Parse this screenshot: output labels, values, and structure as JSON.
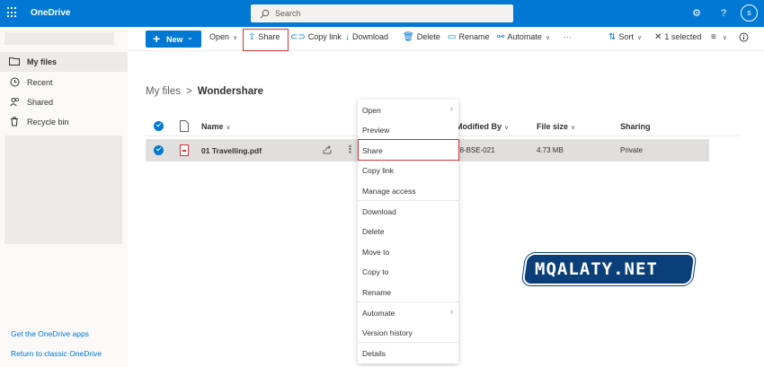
{
  "app": {
    "brand": "OneDrive"
  },
  "search": {
    "placeholder": "Search"
  },
  "topbar": {
    "settings_icon": "gear-icon",
    "help_label": "?",
    "avatar_initial": "s"
  },
  "leftnav": {
    "items": [
      {
        "label": "My files",
        "icon": "folder-icon",
        "active": true
      },
      {
        "label": "Recent",
        "icon": "clock-icon"
      },
      {
        "label": "Shared",
        "icon": "people-icon"
      },
      {
        "label": "Recycle bin",
        "icon": "trash-icon"
      }
    ],
    "get_apps": "Get the OneDrive apps",
    "classic": "Return to classic OneDrive"
  },
  "toolbar": {
    "new_label": "New",
    "open_label": "Open",
    "share_label": "Share",
    "copy_link_label": "Copy link",
    "download_label": "Download",
    "delete_label": "Delete",
    "rename_label": "Rename",
    "automate_label": "Automate",
    "more_label": "···",
    "sort_label": "Sort",
    "selected_label": "1 selected"
  },
  "breadcrumb": {
    "root": "My files",
    "separator": ">",
    "current": "Wondershare"
  },
  "columns": {
    "name": "Name",
    "modified_by": "Modified By",
    "file_size": "File size",
    "sharing": "Sharing"
  },
  "files": [
    {
      "name": "01 Travelling.pdf",
      "modified_by": "18-BSE-021",
      "size": "4.73 MB",
      "sharing": "Private"
    }
  ],
  "context_menu": {
    "items": [
      "Open",
      "Preview",
      "Share",
      "Copy link",
      "Manage access",
      "Download",
      "Delete",
      "Move to",
      "Copy to",
      "Rename",
      "Automate",
      "Version history",
      "Details"
    ]
  },
  "watermark": "MQALATY.NET",
  "colors": {
    "accent": "#0078d4",
    "highlight": "#d13438",
    "watermark": "#0b3f7a"
  }
}
